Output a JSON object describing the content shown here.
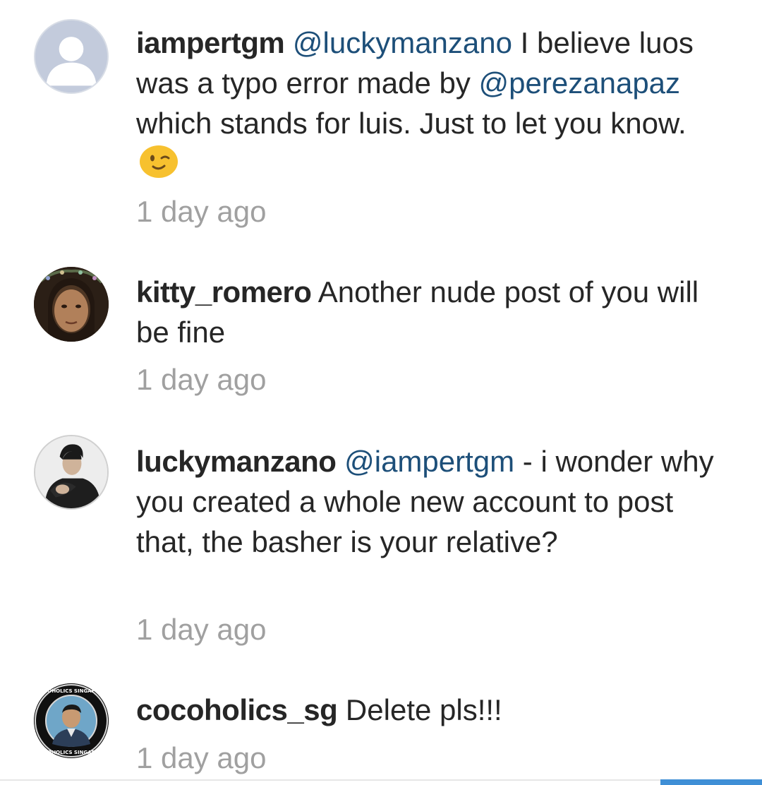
{
  "comments": [
    {
      "username": "iampertgm",
      "avatar_icon": "default-user-icon",
      "mention1": "@luckymanzano",
      "text1": " I believe luos was a typo error made by ",
      "mention2": "@perezanapaz",
      "text2": " which stands for luis. Just to let you know.",
      "emoji": "winking-face-emoji",
      "time": "1 day ago"
    },
    {
      "username": "kitty_romero",
      "avatar_icon": "profile-photo-girl",
      "text": " Another nude post of you will be fine",
      "time": "1 day ago"
    },
    {
      "username": "luckymanzano",
      "avatar_icon": "profile-photo-man",
      "mention1": "@iampertgm",
      "text1": " - i wonder why you created a whole new account to post that, the basher is your relative?",
      "time": "1 day ago"
    },
    {
      "username": "cocoholics_sg",
      "avatar_icon": "profile-photo-cocoholics",
      "avatar_badge_text": "COCOHOLICS SINGAPORE",
      "text": " Delete pls!!!",
      "time": "1 day ago"
    }
  ],
  "colors": {
    "mention": "#1d4f79",
    "timestamp": "#a0a0a0",
    "text": "#262626",
    "scroll_thumb": "#3f8fd6"
  }
}
